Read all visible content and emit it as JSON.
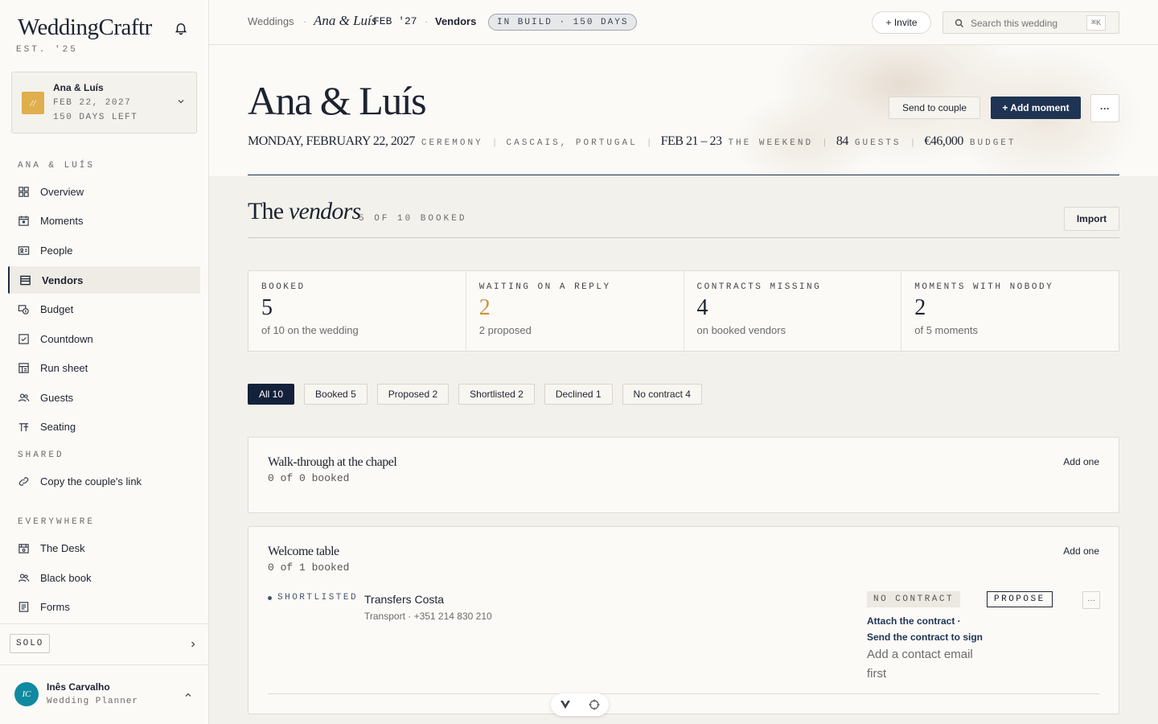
{
  "sidebar": {
    "brand": "WeddingCraftr",
    "brand_sub": "EST. '25",
    "wedding_card": {
      "thumb": "//",
      "name": "Ana & Luís",
      "date": "FEB 22, 2027",
      "days_left": "150 DAYS LEFT"
    },
    "section_wedding": "ANA & LUÍS",
    "items": [
      {
        "label": "Overview",
        "icon": "grid-icon"
      },
      {
        "label": "Moments",
        "icon": "calendar-icon"
      },
      {
        "label": "People",
        "icon": "id-card-icon"
      },
      {
        "label": "Vendors",
        "icon": "store-icon"
      },
      {
        "label": "Budget",
        "icon": "coins-icon"
      },
      {
        "label": "Countdown",
        "icon": "checkbox-icon"
      },
      {
        "label": "Run sheet",
        "icon": "schedule-icon"
      },
      {
        "label": "Guests",
        "icon": "users-icon"
      },
      {
        "label": "Seating",
        "icon": "table-icon"
      }
    ],
    "section_shared": "SHARED",
    "shared_items": [
      {
        "label": "Copy the couple's link",
        "icon": "link-icon"
      }
    ],
    "section_everywhere": "EVERYWHERE",
    "everywhere_items": [
      {
        "label": "The Desk",
        "icon": "desk-icon"
      },
      {
        "label": "Black book",
        "icon": "users-icon"
      },
      {
        "label": "Forms",
        "icon": "form-icon"
      }
    ],
    "plan_badge": "SOLO",
    "user": {
      "initials": "IC",
      "name": "Inês Carvalho",
      "role": "Wedding Planner"
    }
  },
  "topbar": {
    "crumb_root": "Weddings",
    "crumb_sep": "·",
    "crumb_wedding": "Ana & Luís",
    "crumb_date": "FEB '27",
    "crumb_page": "Vendors",
    "status_pill": "IN BUILD · 150 DAYS",
    "invite_label": "+ Invite",
    "search_placeholder": "Search this wedding",
    "search_shortcut": "⌘K"
  },
  "hero": {
    "title": "Ana & Luís",
    "date": "MONDAY, FEBRUARY 22, 2027",
    "date_label": "CEREMONY",
    "location": "CASCAIS, PORTUGAL",
    "weekend": "FEB 21 – 23",
    "weekend_label": "THE WEEKEND",
    "guests": "84",
    "guests_label": "GUESTS",
    "budget": "€46,000",
    "budget_label": "BUDGET",
    "send_label": "Send to couple",
    "add_moment_label": "+ Add moment",
    "more_label": "···"
  },
  "vendors": {
    "title_plain": "The",
    "title_italic": "vendors",
    "subtitle": "5 OF 10 BOOKED",
    "import_label": "Import",
    "stats": [
      {
        "label": "BOOKED",
        "value": "5",
        "sub": "of 10 on the wedding",
        "color": "#1d2330"
      },
      {
        "label": "WAITING ON A REPLY",
        "value": "2",
        "sub": "2 proposed",
        "color": "#c9953f"
      },
      {
        "label": "CONTRACTS MISSING",
        "value": "4",
        "sub": "on booked vendors",
        "color": "#1d2330"
      },
      {
        "label": "MOMENTS WITH NOBODY",
        "value": "2",
        "sub": "of 5 moments",
        "color": "#1d2330"
      }
    ],
    "filters": [
      "All 10",
      "Booked 5",
      "Proposed 2",
      "Shortlisted 2",
      "Declined 1",
      "No contract 4"
    ],
    "moments": [
      {
        "title": "Walk-through at the chapel",
        "count": "0 of 0 booked",
        "add_label": "Add one"
      },
      {
        "title": "Welcome table",
        "count": "0 of 1 booked",
        "add_label": "Add one",
        "vendor": {
          "status": "SHORTLISTED",
          "name": "Transfers Costa",
          "meta": "Transport · +351 214 830 210",
          "contract_badge": "NO CONTRACT",
          "propose_label": "PROPOSE",
          "more_label": "···",
          "attach_link": "Attach the contract ·",
          "send_link": "Send the contract to sign",
          "hint": "Add a contact email first"
        }
      }
    ]
  },
  "floatbar": {
    "icon_a": "logo-v-icon",
    "icon_b": "crosshair-icon"
  }
}
